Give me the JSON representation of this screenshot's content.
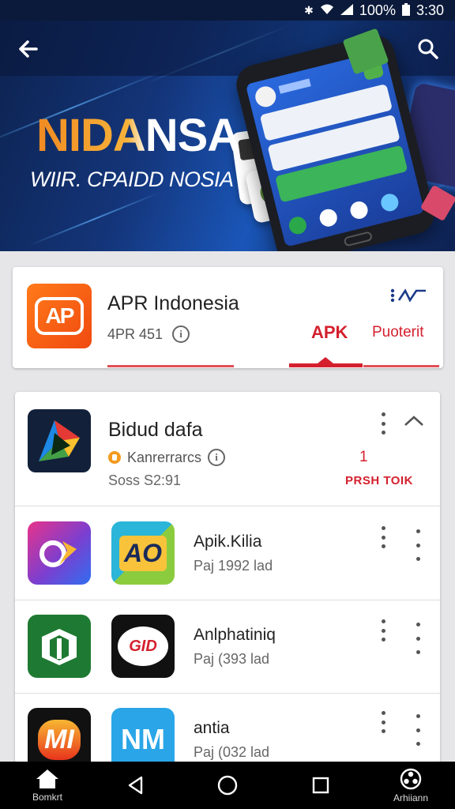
{
  "status_bar": {
    "battery": "100%",
    "time": "3:30",
    "icons": [
      "bluetooth-icon",
      "wifi-icon",
      "signal-icon",
      "battery-icon"
    ]
  },
  "hero": {
    "title": "NIDANSA",
    "subtitle": "WIIR. CPAIDD NOSIA"
  },
  "featured": {
    "icon_text": "AP",
    "title": "APR Indonesia",
    "subtitle": "4PR 451",
    "corner_text": "⁙  ™∕∕",
    "tabs": [
      {
        "label": "APK"
      },
      {
        "label": "Puoterit"
      }
    ]
  },
  "list": {
    "first": {
      "title": "Bidud dafa",
      "meta": "Kanrerrarcs",
      "size": "Soss S2:91",
      "count": "1",
      "action": "PRSH TOIK"
    },
    "rows": [
      {
        "title": "Apik.Kilia",
        "subtitle": "Paj 1992 lad",
        "icon_b_text": "AO"
      },
      {
        "title": "Anlphatiniq",
        "subtitle": "Paj (393 lad",
        "icon_b_text": "GID"
      },
      {
        "title": "antia",
        "subtitle": "Paj (032 lad",
        "icon_a_text": "MI",
        "icon_b_text": "NM"
      }
    ]
  },
  "nav": {
    "home_label": "Bomkrt",
    "right_label": "Arhiiann"
  },
  "colors": {
    "accent_red": "#d4202e",
    "orange": "#f08a22",
    "hero_blue": "#14357a"
  }
}
